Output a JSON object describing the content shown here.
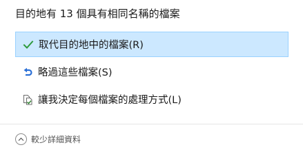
{
  "dialog": {
    "title": "目的地有 13 個具有相同名稱的檔案"
  },
  "options": {
    "replace": {
      "label": "取代目的地中的檔案(R)",
      "icon": "checkmark-icon",
      "icon_color": "#2d9a3c",
      "selected": true
    },
    "skip": {
      "label": "略過這些檔案(S)",
      "icon": "skip-arrow-icon",
      "icon_color": "#2a6fd6"
    },
    "decide": {
      "label": "讓我決定每個檔案的處理方式(L)",
      "icon": "compare-files-icon",
      "icon_color": "#3a8a3a"
    }
  },
  "footer": {
    "less_details_label": "較少詳細資料",
    "icon": "chevron-up-icon"
  },
  "colors": {
    "selected_background": "#cce8ff",
    "selected_border": "#99d1ff"
  }
}
